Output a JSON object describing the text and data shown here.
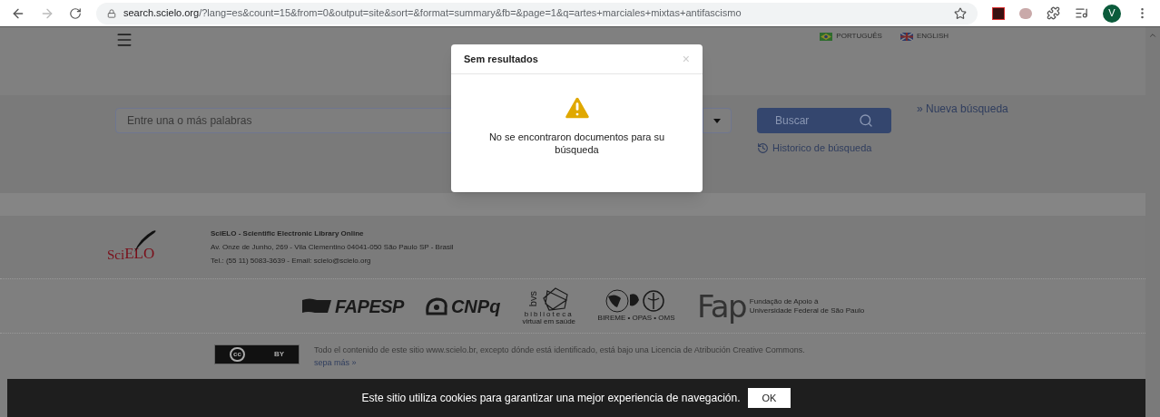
{
  "browser": {
    "url_host": "search.scielo.org",
    "url_path": "/?lang=es&count=15&from=0&output=site&sort=&format=summary&fb=&page=1&q=artes+marciales+mixtas+antifascismo",
    "profile_initial": "V"
  },
  "header": {
    "languages": [
      {
        "label": "PORTUGUÊS",
        "kind": "br"
      },
      {
        "label": "ENGLISH",
        "kind": "uk"
      }
    ]
  },
  "search": {
    "placeholder": "Entre una o más palabras",
    "button": "Buscar",
    "new_search": "» Nueva búsqueda",
    "history": "Historico de búsqueda"
  },
  "modal": {
    "title": "Sem resultados",
    "close": "×",
    "message": "No se encontraron documentos para su búsqueda"
  },
  "footer": {
    "logo": {
      "left": "Sci",
      "right": "ELO"
    },
    "lines": [
      "SciELO - Scientific Electronic Library Online",
      "Av. Onze de Junho, 269 - Vila Clementino 04041-050 São Paulo SP - Brasil",
      "Tel.: (55 11) 5083-3639 - Email: scielo@scielo.org"
    ],
    "partners": [
      {
        "kind": "fapesp",
        "text": "FAPESP"
      },
      {
        "kind": "cnpq",
        "text": "CNPq"
      },
      {
        "kind": "bvs",
        "text": "bvs",
        "caption": "biblioteca",
        "subcaption": "virtual em saúde"
      },
      {
        "kind": "bireme",
        "caption": "BIREME • OPAS • OMS"
      },
      {
        "kind": "fap",
        "text": "Fap",
        "caption": "Fundação de Apoio à",
        "subcaption": "Universidade Federal de São Paulo"
      }
    ],
    "license_badge": {
      "left": "cc",
      "right": "BY"
    },
    "license": "Todo el contenido de este sitio www.scielo.br, excepto dónde está identificado, está bajo una Licencia de Atribución Creative Commons.",
    "more": "sepa más »"
  },
  "cookie": {
    "message": "Este sitio utiliza cookies para garantizar una mejor experiencia de navegación.",
    "button": "OK"
  }
}
